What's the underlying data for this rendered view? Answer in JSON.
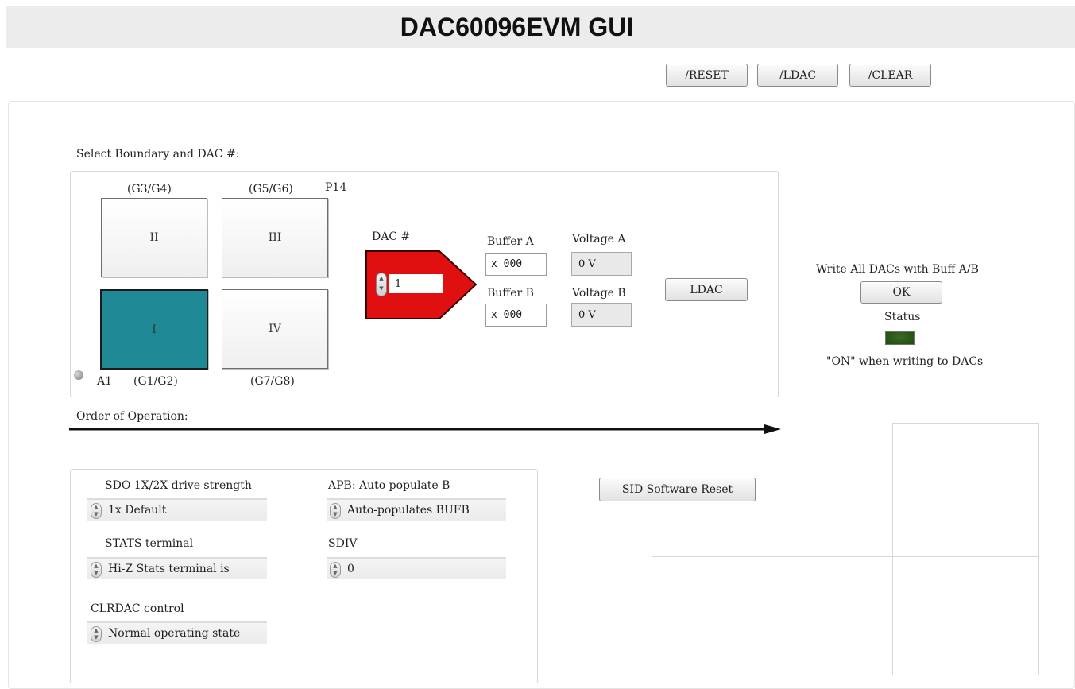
{
  "header": {
    "title": "DAC60096EVM GUI"
  },
  "toolbar": {
    "reset_label": "/RESET",
    "ldac_label": "/LDAC",
    "clear_label": "/CLEAR"
  },
  "boundary": {
    "section_label": "Select Boundary and DAC #:",
    "connector_label": "P14",
    "pin_label": "A1",
    "top_labels": [
      "(G3/G4)",
      "(G5/G6)"
    ],
    "bottom_labels": [
      "(G1/G2)",
      "(G7/G8)"
    ],
    "quadrants": {
      "II": "II",
      "III": "III",
      "I": "I",
      "IV": "IV"
    },
    "selected": "I"
  },
  "dac": {
    "label": "DAC #",
    "value": "1",
    "buffer_a_label": "Buffer A",
    "buffer_a_value": "x 000",
    "buffer_b_label": "Buffer B",
    "buffer_b_value": "x 000",
    "voltage_a_label": "Voltage A",
    "voltage_a_value": "0 V",
    "voltage_b_label": "Voltage B",
    "voltage_b_value": "0 V",
    "ldac_button": "LDAC",
    "arrow_color": "#e01010"
  },
  "write_all": {
    "label": "Write All DACs with Buff A/B",
    "ok_label": "OK",
    "status_label": "Status",
    "status_note": "\"ON\" when writing to DACs",
    "led_color": "#1e4a12"
  },
  "order": {
    "label": "Order of Operation:"
  },
  "settings": {
    "sdo_label": "SDO 1X/2X drive strength",
    "sdo_value": "1x Default",
    "stats_label": "STATS terminal",
    "stats_value": "Hi-Z Stats terminal is",
    "clrdac_label": "CLRDAC control",
    "clrdac_value": "Normal operating state",
    "apb_label": "APB: Auto populate B",
    "apb_value": "Auto-populates BUFB",
    "sdiv_label": "SDIV",
    "sdiv_value": "0"
  },
  "sid": {
    "reset_label": "SID Software Reset"
  }
}
